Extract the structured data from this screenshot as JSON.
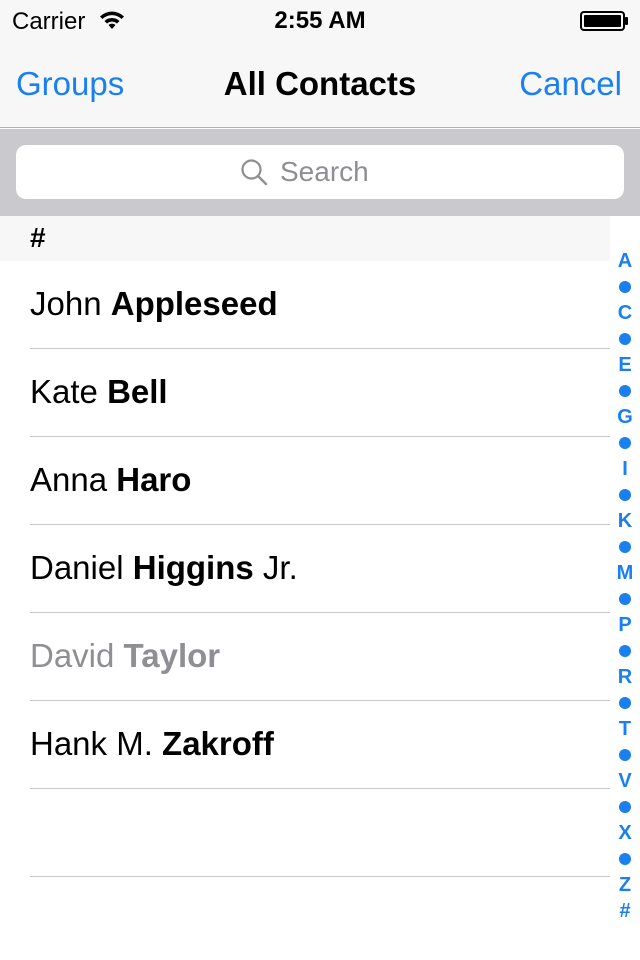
{
  "status_bar": {
    "carrier": "Carrier",
    "time": "2:55 AM",
    "icons": [
      "wifi-icon",
      "battery-icon"
    ]
  },
  "nav": {
    "left_label": "Groups",
    "title": "All Contacts",
    "right_label": "Cancel"
  },
  "search": {
    "placeholder": "Search",
    "icon": "search-icon"
  },
  "section": {
    "title": "#"
  },
  "contacts": [
    {
      "first": "John",
      "last": "Appleseed",
      "suffix": ""
    },
    {
      "first": "Kate",
      "last": "Bell",
      "suffix": ""
    },
    {
      "first": "Anna",
      "last": "Haro",
      "suffix": ""
    },
    {
      "first": "Daniel",
      "last": "Higgins",
      "suffix": "Jr."
    },
    {
      "first": "David",
      "last": "Taylor",
      "suffix": ""
    },
    {
      "first": "Hank M.",
      "last": "Zakroff",
      "suffix": ""
    }
  ],
  "index_letters": [
    "A",
    "C",
    "E",
    "G",
    "I",
    "K",
    "M",
    "P",
    "R",
    "T",
    "V",
    "X",
    "Z",
    "#"
  ],
  "colors": {
    "accent": "#1a80f0",
    "bar_background": "#f7f7f7",
    "search_background": "#c9c9ce",
    "separator": "#c8c7cc",
    "dimmed_text": "#8e8e93"
  }
}
